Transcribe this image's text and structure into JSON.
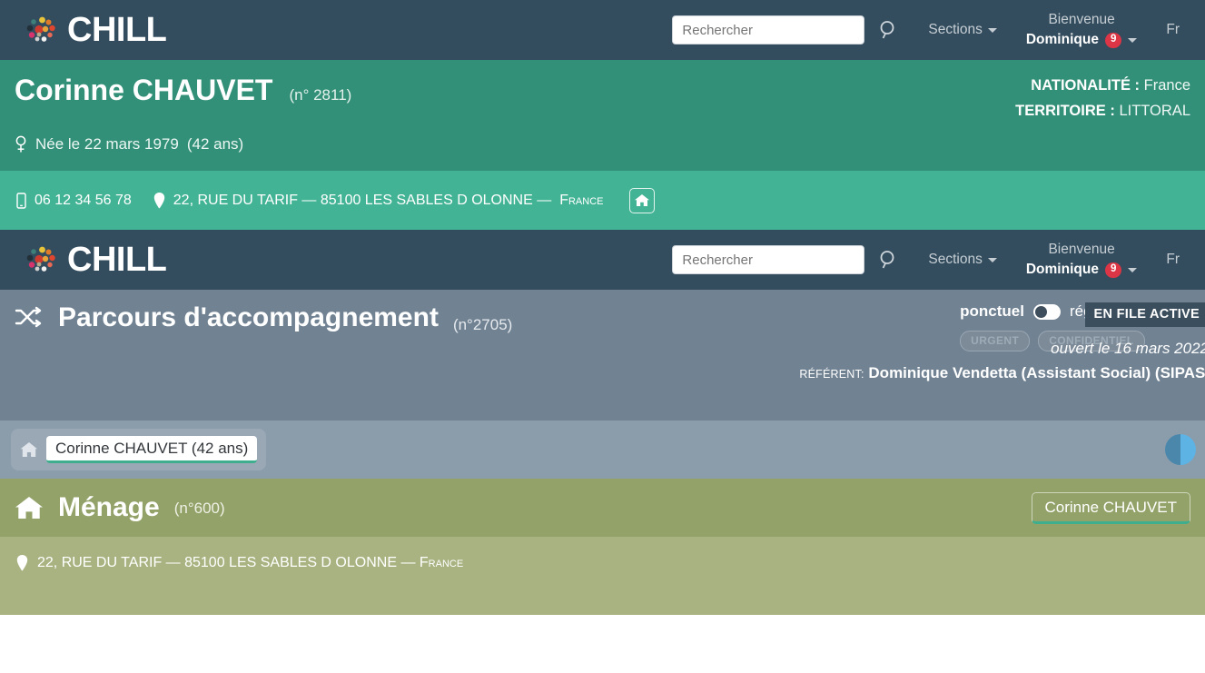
{
  "navbar": {
    "brand": "CHILL",
    "brand_logo_icon": "chill-dots-logo",
    "search_placeholder": "Rechercher",
    "search_value": "",
    "search_icon": "search-icon",
    "sections_label": "Sections",
    "welcome_label": "Bienvenue",
    "user_name": "Dominique",
    "notification_count": "9",
    "language": "Fr"
  },
  "person": {
    "name": "Corinne CHAUVET",
    "number": "(n° 2811)",
    "gender_icon": "female-gender-icon",
    "birth_line": "Née le 22 mars 1979",
    "age": "(42 ans)",
    "nationality_label": "NATIONALITÉ :",
    "nationality_value": "France",
    "territory_label": "TERRITOIRE :",
    "territory_value": "LITTORAL",
    "phone_icon": "mobile-phone-icon",
    "phone": "06 12 34 56 78",
    "address_pin_icon": "map-pin-icon",
    "address_main": "22, RUE DU TARIF — 85100 LES SABLES D OLONNE — ",
    "address_country": "France",
    "household_icon": "home-icon"
  },
  "parcours": {
    "icon": "shuffle-icon",
    "title": "Parcours d'accompagnement",
    "number": "(n°2705)",
    "toggle_left": "ponctuel",
    "toggle_right": "régulier",
    "flags": [
      "URGENT",
      "CONFIDENTIEL"
    ],
    "status_badge": "EN FILE ACTIVE",
    "opened": "ouvert le 16 mars 2022",
    "referent_label": "RÉFÉRENT:",
    "referent_name": "Dominique Vendetta (Assistant Social) (SIPAS)"
  },
  "breadcrumb": {
    "home_icon": "home-icon",
    "chip_label": "Corinne CHAUVET (42 ans)",
    "avatar_icon": "half-circle-avatar"
  },
  "menage": {
    "icon": "home-icon",
    "title": "Ménage",
    "number": "(n°600)",
    "member_button": "Corinne CHAUVET",
    "address_pin_icon": "map-pin-icon",
    "address_main": "22, RUE DU TARIF — 85100 LES SABLES D OLONNE — ",
    "address_country": "France"
  },
  "colors": {
    "navbar": "#334d5e",
    "person_banner": "#339078",
    "address_strip": "#43b395",
    "parcours_banner": "#718293",
    "breadcrumb_bar": "#8b9cab",
    "menage_banner": "#93a269",
    "menage_address": "#a8b381",
    "badge_red": "#dc3545",
    "accent_green": "#3fae8e"
  }
}
